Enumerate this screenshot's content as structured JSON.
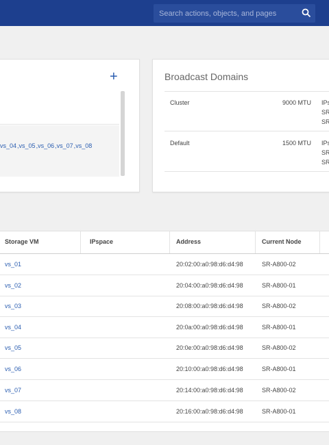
{
  "search": {
    "placeholder": "Search actions, objects, and pages"
  },
  "svm_links": [
    "vs_04",
    "vs_05",
    "vs_06",
    "vs_07",
    "vs_08"
  ],
  "broadcast": {
    "title": "Broadcast Domains",
    "rows": [
      {
        "name": "Cluster",
        "mtu": "9000 MTU",
        "ip": [
          "IPs",
          "SR",
          "SR"
        ]
      },
      {
        "name": "Default",
        "mtu": "1500 MTU",
        "ip": [
          "IPs",
          "SR",
          "SR"
        ]
      }
    ]
  },
  "table": {
    "headers": [
      "Storage VM",
      "IPspace",
      "Address",
      "Current Node"
    ],
    "rows": [
      {
        "svm": "vs_01",
        "ipspace": "",
        "address": "20:02:00:a0:98:d6:d4:98",
        "node": "SR-A800-02"
      },
      {
        "svm": "vs_02",
        "ipspace": "",
        "address": "20:04:00:a0:98:d6:d4:98",
        "node": "SR-A800-01"
      },
      {
        "svm": "vs_03",
        "ipspace": "",
        "address": "20:08:00:a0:98:d6:d4:98",
        "node": "SR-A800-02"
      },
      {
        "svm": "vs_04",
        "ipspace": "",
        "address": "20:0a:00:a0:98:d6:d4:98",
        "node": "SR-A800-01"
      },
      {
        "svm": "vs_05",
        "ipspace": "",
        "address": "20:0e:00:a0:98:d6:d4:98",
        "node": "SR-A800-02"
      },
      {
        "svm": "vs_06",
        "ipspace": "",
        "address": "20:10:00:a0:98:d6:d4:98",
        "node": "SR-A800-01"
      },
      {
        "svm": "vs_07",
        "ipspace": "",
        "address": "20:14:00:a0:98:d6:d4:98",
        "node": "SR-A800-02"
      },
      {
        "svm": "vs_08",
        "ipspace": "",
        "address": "20:16:00:a0:98:d6:d4:98",
        "node": "SR-A800-01"
      }
    ]
  },
  "colors": {
    "brand": "#1d3f8e",
    "link": "#2a5db0"
  },
  "icons": {
    "search": "search-icon",
    "add": "plus-icon"
  }
}
